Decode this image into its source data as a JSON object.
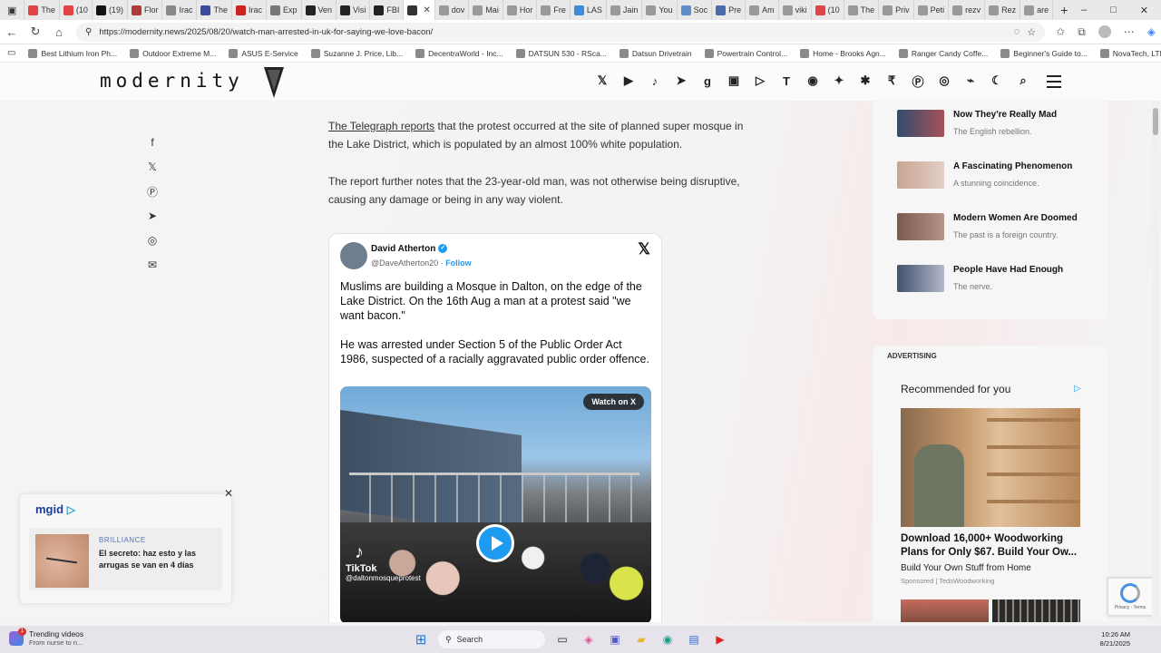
{
  "browser": {
    "tabs": [
      {
        "label": "The",
        "color": "#e04444"
      },
      {
        "label": "(10",
        "color": "#e04444"
      },
      {
        "label": "(19)",
        "color": "#111111"
      },
      {
        "label": "Flor",
        "color": "#b03a3a"
      },
      {
        "label": "Irac",
        "color": "#888888"
      },
      {
        "label": "The",
        "color": "#3a4aa0"
      },
      {
        "label": "Irac",
        "color": "#cc2222"
      },
      {
        "label": "Exp",
        "color": "#777777"
      },
      {
        "label": "Ven",
        "color": "#222222"
      },
      {
        "label": "Visi",
        "color": "#222222"
      },
      {
        "label": "FBI",
        "color": "#222222"
      },
      {
        "label": "",
        "color": "#333333",
        "active": true
      },
      {
        "label": "dov",
        "color": "#999999"
      },
      {
        "label": "Mai",
        "color": "#999999"
      },
      {
        "label": "Hor",
        "color": "#999999"
      },
      {
        "label": "Fre",
        "color": "#999999"
      },
      {
        "label": "LAS",
        "color": "#3b8fd9"
      },
      {
        "label": "Jain",
        "color": "#999999"
      },
      {
        "label": "You",
        "color": "#999999"
      },
      {
        "label": "Soc",
        "color": "#5f8fc9"
      },
      {
        "label": "Pre",
        "color": "#4a6aaa"
      },
      {
        "label": "Am",
        "color": "#999999"
      },
      {
        "label": "viki",
        "color": "#999999"
      },
      {
        "label": "(10",
        "color": "#e04444"
      },
      {
        "label": "The",
        "color": "#999999"
      },
      {
        "label": "Priv",
        "color": "#999999"
      },
      {
        "label": "Peti",
        "color": "#999999"
      },
      {
        "label": "rezv",
        "color": "#999999"
      },
      {
        "label": "Rez",
        "color": "#999999"
      },
      {
        "label": "are",
        "color": "#999999"
      }
    ],
    "new_tab": "+",
    "window_controls": [
      "–",
      "□",
      "✕"
    ],
    "url": "https://modernity.news/2025/08/20/watch-man-arrested-in-uk-for-saying-we-love-bacon/",
    "bookmarks": [
      "Best Lithium Iron Ph...",
      "Outdoor Extreme M...",
      "ASUS E-Service",
      "Suzanne J. Price, Lib...",
      "DecentraWorld - Inc...",
      "DATSUN 530 - RSca...",
      "Datsun Drivetrain",
      "Powertrain Control...",
      "Home - Brooks Agn...",
      "Ranger Candy Coffe...",
      "Beginner's Guide to...",
      "NovaTech, LTD - Sin..."
    ]
  },
  "site": {
    "logo_text": "modernity",
    "social_icons": [
      "x-icon",
      "youtube-icon",
      "tiktok-icon",
      "telegram-icon",
      "gab-icon",
      "minds-icon",
      "rumble-icon",
      "truth-social-icon",
      "gettr-icon",
      "locals-icon",
      "substack-icon",
      "subscribestar-icon",
      "pinterest-icon",
      "reddit-icon",
      "rss-icon",
      "dark-mode-icon",
      "search-icon"
    ],
    "social_glyphs": [
      "𝕏",
      "▶",
      "♪",
      "➤",
      "g",
      "▣",
      "▷",
      "T",
      "◉",
      "✦",
      "✱",
      "₹",
      "Ⓟ",
      "◎",
      "⌁",
      "☾",
      "⌕"
    ]
  },
  "share": {
    "icons": [
      "facebook-icon",
      "x-icon",
      "pinterest-icon",
      "telegram-icon",
      "reddit-icon",
      "email-icon"
    ],
    "glyphs": [
      "f",
      "𝕏",
      "Ⓟ",
      "➤",
      "◎",
      "✉"
    ]
  },
  "article": {
    "partial_top": "",
    "p1_link": "The Telegraph reports",
    "p1_rest": " that the protest occurred at the site of planned super mosque in the Lake District, which is populated by an almost 100% white population.",
    "p2": "The report further notes that the 23-year-old man, was not otherwise being disruptive, causing any damage or being in any way violent."
  },
  "tweet": {
    "name": "David Atherton",
    "handle": "@DaveAtherton20",
    "follow": "Follow",
    "p1": "Muslims are building a Mosque in Dalton, on the edge of the Lake District. On the 16th Aug a man at a protest said \"we want bacon.\"",
    "p2": "He was arrested under Section 5 of the Public Order Act 1986, suspected of a racially aggravated public order offence.",
    "watch_label": "Watch on X",
    "tiktok_label": "TikTok",
    "tiktok_handle": "@daltonmosqueprotest"
  },
  "sidebar": {
    "items": [
      {
        "title": "Now They're Really Mad",
        "sub": "The English rebellion."
      },
      {
        "title": "A Fascinating Phenomenon",
        "sub": "A stunning coincidence."
      },
      {
        "title": "Modern Women Are Doomed",
        "sub": "The past is a foreign country."
      },
      {
        "title": "People Have Had Enough",
        "sub": "The nerve."
      }
    ]
  },
  "ad": {
    "label": "ADVERTISING",
    "recommended": "Recommended for you",
    "title": "Download 16,000+ Woodworking Plans for Only $67. Build Your Ow...",
    "desc": "Build Your Own Stuff from Home",
    "sponsored": "Sponsored | TedsWoodworking"
  },
  "recaptcha": {
    "text": "Privacy - Terms"
  },
  "mgid": {
    "logo": "mgid",
    "close": "✕",
    "brand": "BRILLIANCE",
    "text": "El secreto: haz esto y las arrugas se van en 4 días"
  },
  "taskbar": {
    "trend_title": "Trending videos",
    "trend_sub": "From nurse to n...",
    "search": "Search",
    "time": "10:26 AM",
    "date": "8/21/2025"
  }
}
